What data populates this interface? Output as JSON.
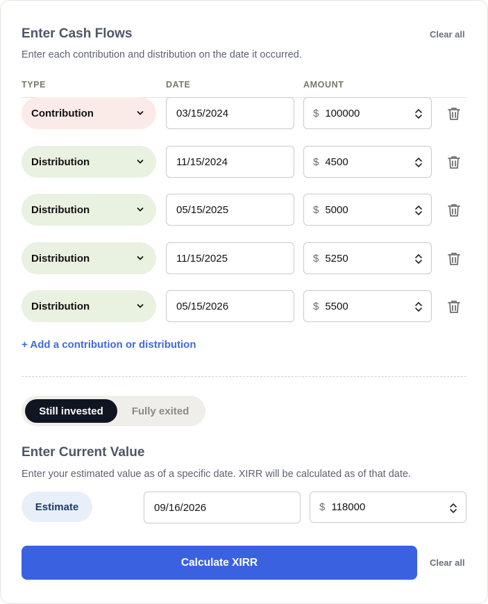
{
  "header": {
    "title": "Enter Cash Flows",
    "clear_all_label": "Clear all",
    "subtitle": "Enter each contribution and distribution on the date it occurred."
  },
  "columns": {
    "type": "TYPE",
    "date": "DATE",
    "amount": "AMOUNT"
  },
  "cash_flows": [
    {
      "type": "Contribution",
      "date": "03/15/2024",
      "currency": "$",
      "amount": "100000"
    },
    {
      "type": "Distribution",
      "date": "11/15/2024",
      "currency": "$",
      "amount": "4500"
    },
    {
      "type": "Distribution",
      "date": "05/15/2025",
      "currency": "$",
      "amount": "5000"
    },
    {
      "type": "Distribution",
      "date": "11/15/2025",
      "currency": "$",
      "amount": "5250"
    },
    {
      "type": "Distribution",
      "date": "05/15/2026",
      "currency": "$",
      "amount": "5500"
    }
  ],
  "add_link_label": "+ Add a contribution or distribution",
  "status_toggle": {
    "selected": "Still invested",
    "other": "Fully exited"
  },
  "current_value": {
    "title": "Enter Current Value",
    "subtitle": "Enter your estimated value as of a specific date. XIRR will be calculated as of that date.",
    "mode_label": "Estimate",
    "date": "09/16/2026",
    "currency": "$",
    "amount": "118000"
  },
  "footer": {
    "calculate_label": "Calculate XIRR",
    "clear_all_label": "Clear all"
  },
  "colors": {
    "contribution_bg": "#fbebe8",
    "distribution_bg": "#e9f1e1",
    "primary_button": "#3a62e0",
    "link": "#3e6bd8",
    "toggle_active": "#101522"
  },
  "icons": {
    "type_dropdown": "chevron-down-icon",
    "amount_stepper": "spinner-icon",
    "remove_row": "trash-icon"
  }
}
